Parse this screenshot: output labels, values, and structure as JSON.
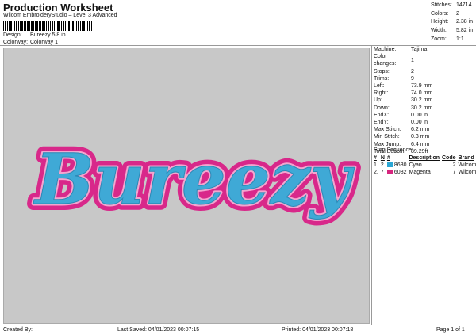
{
  "header": {
    "title": "Production Worksheet",
    "subtitle": "Wilcom EmbroideryStudio – Level 3 Advanced"
  },
  "design_info": {
    "design_label": "Design:",
    "design_value": "Bureezy 5,8 in",
    "colorway_label": "Colorway:",
    "colorway_value": "Colorway 1"
  },
  "summary": [
    {
      "label": "Stitches:",
      "value": "14714"
    },
    {
      "label": "Colors:",
      "value": "2"
    },
    {
      "label": "Height:",
      "value": "2.38 in"
    },
    {
      "label": "Width:",
      "value": "5.82 in"
    },
    {
      "label": "Zoom:",
      "value": "1:1"
    }
  ],
  "machine_info": [
    {
      "label": "Machine:",
      "value": "Tajima"
    },
    {
      "label": "Color changes:",
      "value": "1"
    },
    {
      "label": "Stops:",
      "value": "2"
    },
    {
      "label": "Trims:",
      "value": "9"
    },
    {
      "label": "Left:",
      "value": "73.9 mm"
    },
    {
      "label": "Right:",
      "value": "74.0 mm"
    },
    {
      "label": "Up:",
      "value": "30.2 mm"
    },
    {
      "label": "Down:",
      "value": "30.2 mm"
    },
    {
      "label": "EndX:",
      "value": "0.00 in"
    },
    {
      "label": "EndY:",
      "value": "0.00 in"
    },
    {
      "label": "Max Stitch:",
      "value": "6.2 mm"
    },
    {
      "label": "Min Stitch:",
      "value": "0.3 mm"
    },
    {
      "label": "Max Jump:",
      "value": "6.4 mm"
    },
    {
      "label": "Total Bobbin:",
      "value": "89.29ft"
    }
  ],
  "stop_sequence": {
    "title": "Stop Sequence:",
    "headers": [
      "#",
      "N",
      "#",
      "Description",
      "Code",
      "Brand"
    ],
    "rows": [
      {
        "num": "1.",
        "n": "2",
        "thread": "8630",
        "description": "Cyan",
        "code": "2",
        "brand": "Wilcom",
        "color": "#2aa6d4"
      },
      {
        "num": "2.",
        "n": "7",
        "thread": "6082",
        "description": "Magenta",
        "code": "7",
        "brand": "Wilcom",
        "color": "#d6257e"
      }
    ]
  },
  "design_preview": {
    "text": "Bureezy",
    "fill_color": "#3fa9d6",
    "outline_color": "#d8288a",
    "background_color": "#c8c8c8"
  },
  "footer": {
    "created_by": "Created By:",
    "last_saved": "Last Saved: 04/01/2023 00:07:15",
    "printed": "Printed: 04/01/2023 00:07:18",
    "page": "Page 1 of 1"
  }
}
